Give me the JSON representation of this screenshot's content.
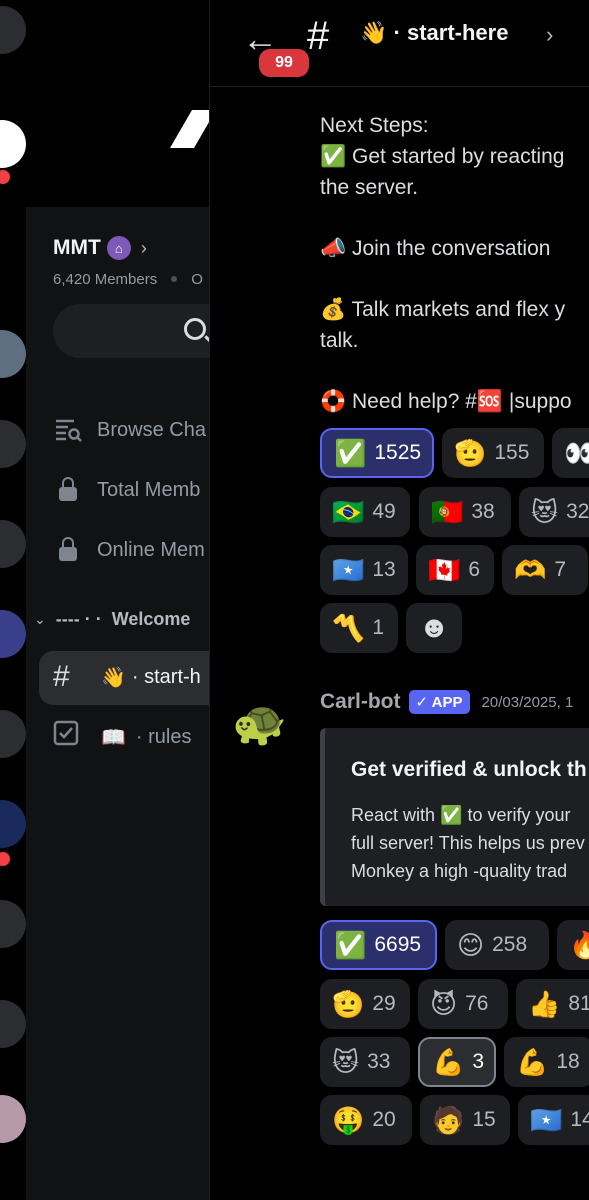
{
  "server": {
    "name": "MMT",
    "member_count": "6,420 Members",
    "member_online_partial": "O",
    "search_placeholder": ""
  },
  "sidebar": {
    "items": [
      {
        "label": "Browse Cha",
        "icon": "browse-channels-icon"
      },
      {
        "label": "Total Memb",
        "icon": "lock-icon"
      },
      {
        "label": "Online Mem",
        "icon": "lock-icon"
      }
    ],
    "category": "Welcome",
    "category_prefix": "---- · ·",
    "channels": [
      {
        "emoji": "👋",
        "label": "· start-h",
        "active": true
      },
      {
        "emoji": "📖",
        "label": "· rules",
        "active": false
      }
    ]
  },
  "topbar": {
    "back_badge": "99",
    "emoji": "👋",
    "title": "· start-here"
  },
  "messages": {
    "intro_lines": [
      "Next Steps:",
      "✅ Get started by reacting",
      "the server.",
      "📣  Join the conversation",
      "💰 Talk markets and flex y",
      "talk.",
      "🛟 Need help? #🆘 |suppo"
    ],
    "reactions_1": [
      {
        "emoji": "✅",
        "count": "1525",
        "me": true
      },
      {
        "emoji": "🫡",
        "count": "155"
      },
      {
        "emoji": "👀",
        "count": ""
      },
      {
        "emoji": "🇧🇷",
        "count": "49"
      },
      {
        "emoji": "🇵🇹",
        "count": "38"
      },
      {
        "emoji": "😻",
        "count": "32"
      },
      {
        "emoji": "🇸🇴",
        "count": "13"
      },
      {
        "emoji": "🇨🇦",
        "count": "6"
      },
      {
        "emoji": "🫶",
        "count": "7"
      },
      {
        "emoji": "〽️",
        "count": "1"
      },
      {
        "emoji": "☻",
        "count": ""
      }
    ],
    "bot": {
      "author": "Carl-bot",
      "tag": "✓ APP",
      "timestamp": "20/03/2025, 1",
      "avatar": "🐢",
      "embed_title": "Get verified & unlock th",
      "embed_lines": [
        "React with ✅ to verify your",
        "full server! This helps us prev",
        "Monkey  a high -quality trad"
      ]
    },
    "reactions_2": [
      {
        "emoji": "✅",
        "count": "6695",
        "me": true
      },
      {
        "emoji": "😊",
        "count": "258"
      },
      {
        "emoji": "🔥",
        "count": ""
      },
      {
        "emoji": "🫡",
        "count": "29"
      },
      {
        "emoji": "😈",
        "count": "76"
      },
      {
        "emoji": "👍",
        "count": "81"
      },
      {
        "emoji": "😻",
        "count": "33"
      },
      {
        "emoji": "💪",
        "count": "3",
        "selected": true
      },
      {
        "emoji": "💪",
        "count": "18"
      },
      {
        "emoji": "🤑",
        "count": "20"
      },
      {
        "emoji": "🧑",
        "count": "15"
      },
      {
        "emoji": "🇸🇴",
        "count": "14"
      }
    ]
  },
  "colors": {
    "accent": "#5865f2",
    "badge_red": "#da373c",
    "sidebar_bg": "#111214",
    "reaction_bg": "#1e1f22"
  }
}
